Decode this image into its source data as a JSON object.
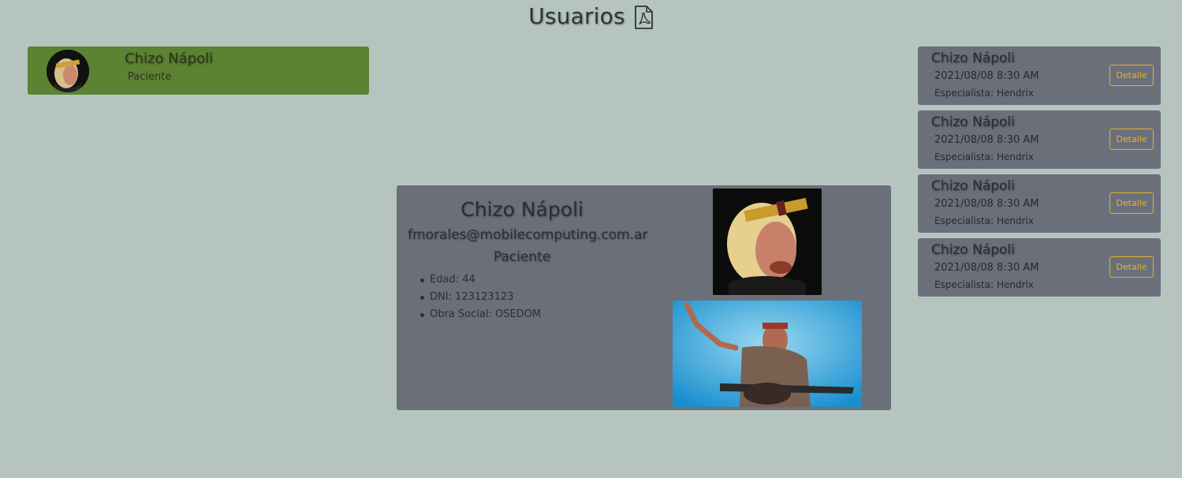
{
  "header": {
    "title": "Usuarios",
    "export_icon": "pdf-file-icon"
  },
  "user_list": [
    {
      "name": "Chizo Nápoli",
      "role": "Paciente",
      "avatar_icon": "user-avatar-photo"
    }
  ],
  "detail": {
    "name": "Chizo Nápoli",
    "email": "fmorales@mobilecomputing.com.ar",
    "role": "Paciente",
    "items": [
      "Edad: 44",
      "DNI: 123123123",
      "Obra Social: OSEDOM"
    ]
  },
  "appointments": [
    {
      "name": "Chizo Nápoli",
      "datetime": "2021/08/08 8:30 AM",
      "specialist": "Especialista: Hendrix",
      "button_label": "Detalle"
    },
    {
      "name": "Chizo Nápoli",
      "datetime": "2021/08/08 8:30 AM",
      "specialist": "Especialista: Hendrix",
      "button_label": "Detalle"
    },
    {
      "name": "Chizo Nápoli",
      "datetime": "2021/08/08 8:30 AM",
      "specialist": "Especialista: Hendrix",
      "button_label": "Detalle"
    },
    {
      "name": "Chizo Nápoli",
      "datetime": "2021/08/08 8:30 AM",
      "specialist": "Especialista: Hendrix",
      "button_label": "Detalle"
    }
  ],
  "colors": {
    "background": "#b5c4bf",
    "selected_user": "#5b8332",
    "panel": "#6a6f79",
    "accent_button": "#e8b422"
  }
}
